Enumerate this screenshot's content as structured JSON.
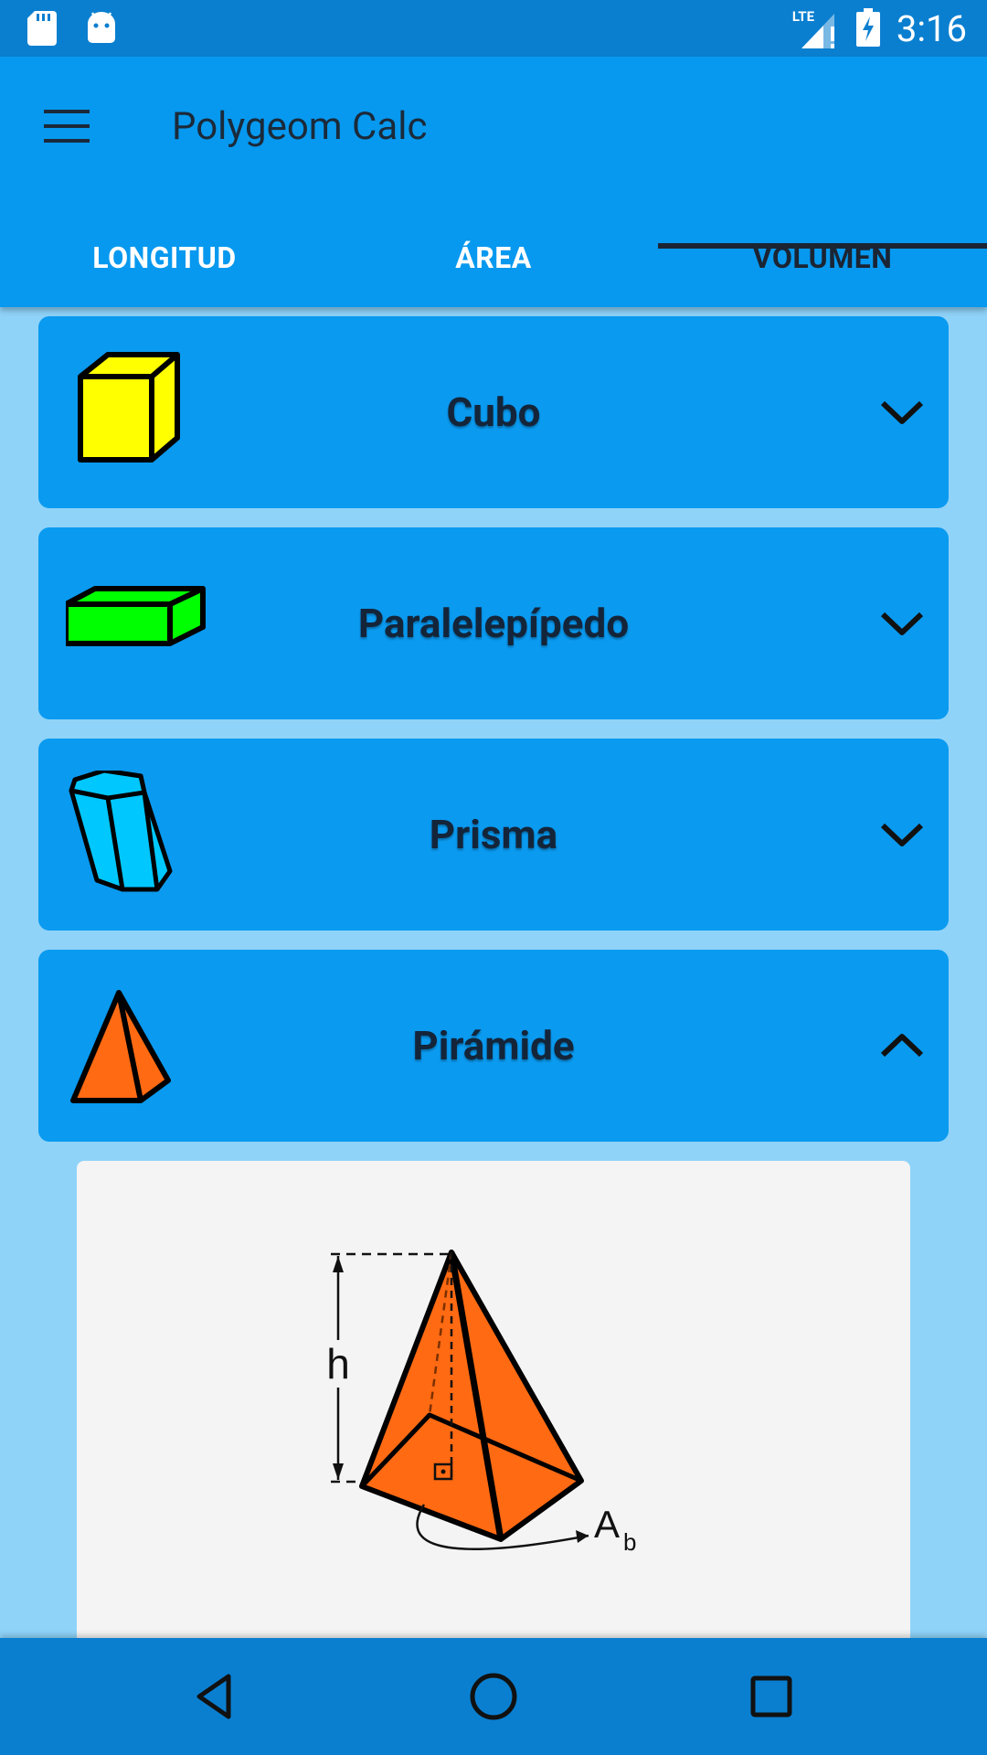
{
  "status_bar": {
    "time": "3:16",
    "network": "LTE",
    "icons": [
      "sd-card-icon",
      "android-icon",
      "signal-icon",
      "battery-charging-icon"
    ]
  },
  "app_bar": {
    "title": "Polygeom Calc",
    "menu_icon": "hamburger-menu-icon"
  },
  "tabs": [
    {
      "label": "LONGITUD",
      "active": false
    },
    {
      "label": "ÁREA",
      "active": false
    },
    {
      "label": "VOLUMEN",
      "active": true
    }
  ],
  "shapes": [
    {
      "label": "Cubo",
      "icon": "cube-icon",
      "expanded": false
    },
    {
      "label": "Paralelepípedo",
      "icon": "box-icon",
      "expanded": false
    },
    {
      "label": "Prisma",
      "icon": "prism-icon",
      "expanded": false
    },
    {
      "label": "Pirámide",
      "icon": "pyramid-icon",
      "expanded": true
    }
  ],
  "pyramid_diagram": {
    "height_label": "h",
    "base_area_label": "A",
    "base_area_subscript": "b"
  },
  "nav_bar": {
    "icons": [
      "back-icon",
      "home-icon",
      "recents-icon"
    ]
  },
  "colors": {
    "status_bar": "#0a7fd0",
    "app_bar": "#0799ef",
    "background": "#8fd3f9",
    "card": "#0a9af0",
    "cube": "#ffff00",
    "box": "#00ff00",
    "prism": "#00c8ff",
    "pyramid": "#ff6a13"
  }
}
